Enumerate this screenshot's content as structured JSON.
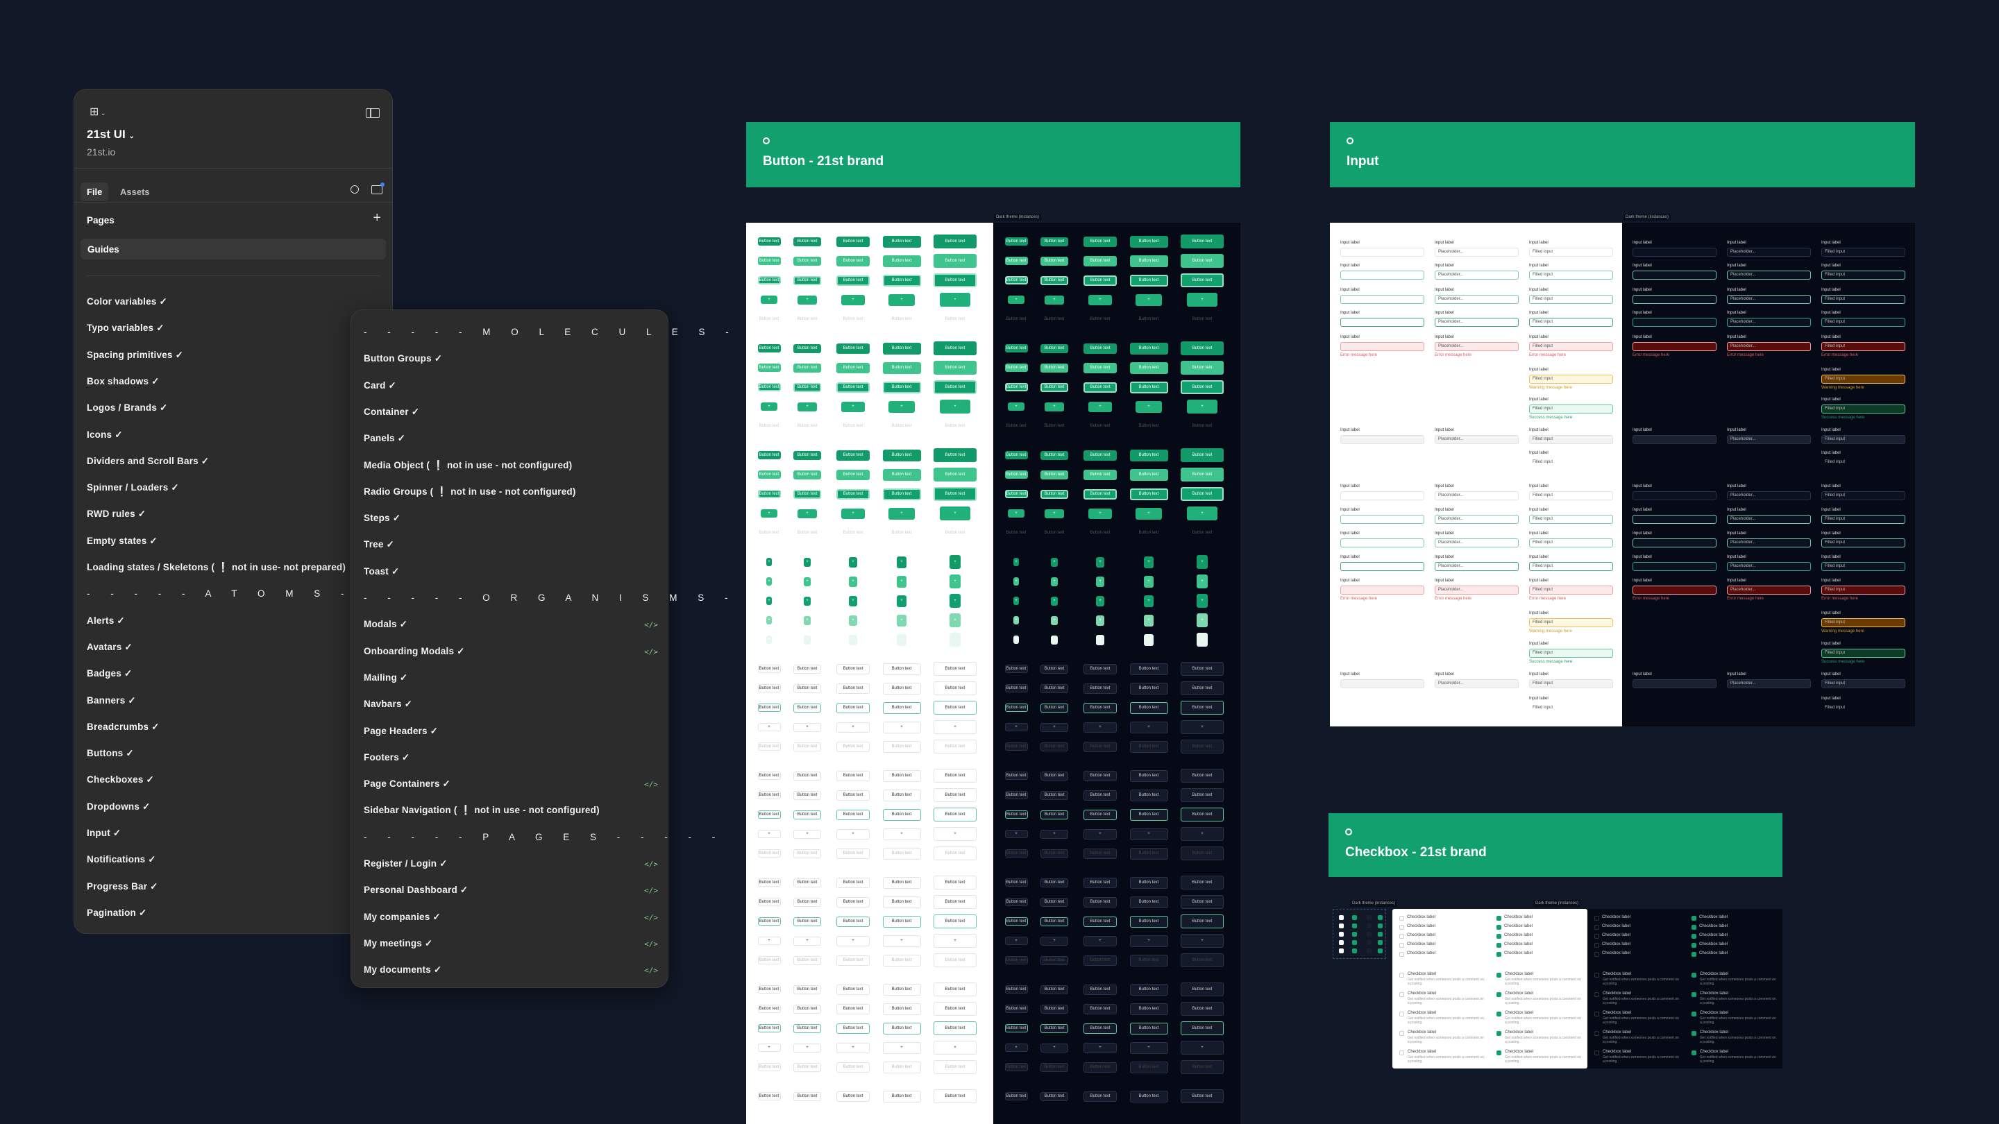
{
  "left_panel": {
    "project_title": "21st UI",
    "project_url": "21st.io",
    "tabs": [
      "File",
      "Assets"
    ],
    "active_tab": "File",
    "pages_label": "Pages",
    "selected_page": "Guides",
    "items": [
      "Color variables ✓",
      "Typo variables ✓",
      "Spacing primitives ✓",
      "Box shadows ✓",
      "Logos / Brands ✓",
      "Icons ✓",
      "Dividers and Scroll Bars ✓",
      "Spinner / Loaders ✓",
      "RWD rules ✓",
      "Empty states ✓",
      "Loading states / Skeletons ( ❕ not in use- not prepared)",
      "- - - - - A T O M S - - - - -",
      "Alerts ✓",
      "Avatars ✓",
      "Badges ✓",
      "Banners ✓",
      "Breadcrumbs ✓",
      "Buttons ✓",
      "Checkboxes ✓",
      "Dropdowns ✓",
      "Input ✓",
      "Notifications ✓",
      "Progress Bar ✓",
      "Pagination ✓"
    ]
  },
  "page_list": {
    "items": [
      {
        "label": "- - - - - M O L E C U L E S - - - - -",
        "code": false
      },
      {
        "label": "Button Groups ✓",
        "code": false
      },
      {
        "label": "Card ✓",
        "code": false
      },
      {
        "label": "Container ✓",
        "code": false
      },
      {
        "label": "Panels ✓",
        "code": false
      },
      {
        "label": "Media Object  ( ❕ not in use - not configured)",
        "code": false
      },
      {
        "label": "Radio Groups ( ❕ not in use - not configured)",
        "code": false
      },
      {
        "label": "Steps ✓",
        "code": false
      },
      {
        "label": "Tree ✓",
        "code": false
      },
      {
        "label": "Toast ✓",
        "code": false
      },
      {
        "label": "- - - - - O R G A N I S M S - - - - -",
        "code": false
      },
      {
        "label": "Modals ✓",
        "code": true
      },
      {
        "label": "Onboarding Modals ✓",
        "code": true
      },
      {
        "label": "Mailing ✓",
        "code": false
      },
      {
        "label": "Navbars ✓",
        "code": false
      },
      {
        "label": "Page Headers ✓",
        "code": false
      },
      {
        "label": "Footers ✓",
        "code": false
      },
      {
        "label": "Page Containers ✓",
        "code": true
      },
      {
        "label": "Sidebar Navigation ( ❕ not in use - not configured)",
        "code": false
      },
      {
        "label": "- - - - - P A G E S - - - - -",
        "code": false
      },
      {
        "label": "Register / Login ✓",
        "code": true
      },
      {
        "label": "Personal Dashboard ✓",
        "code": true
      },
      {
        "label": "My companies  ✓",
        "code": true
      },
      {
        "label": "My meetings ✓",
        "code": true
      },
      {
        "label": "My documents ✓",
        "code": true
      }
    ],
    "code_glyph": "</>"
  },
  "frames": {
    "button": {
      "title": "Button - 21st brand",
      "dark_tag": "Dark theme (instances)",
      "button_text": "Button text"
    },
    "input": {
      "title": "Input",
      "dark_tag": "Dark theme (instances)",
      "label": "Input label",
      "placeholder": "Placeholder...",
      "filled": "Filled input",
      "error": "Error message here",
      "warning": "Warning message here",
      "success": "Success message here"
    },
    "checkbox": {
      "title": "Checkbox - 21st brand",
      "dark_tag": "Dark theme (instances)",
      "label": "Checkbox label",
      "description": "Get notified when someones posts a comment on a posting."
    }
  },
  "colors": {
    "brand": "#12a06e",
    "background": "#111827",
    "panel": "#2c2c2c",
    "dark_canvas": "#060a16",
    "error": "#e05a5a"
  }
}
